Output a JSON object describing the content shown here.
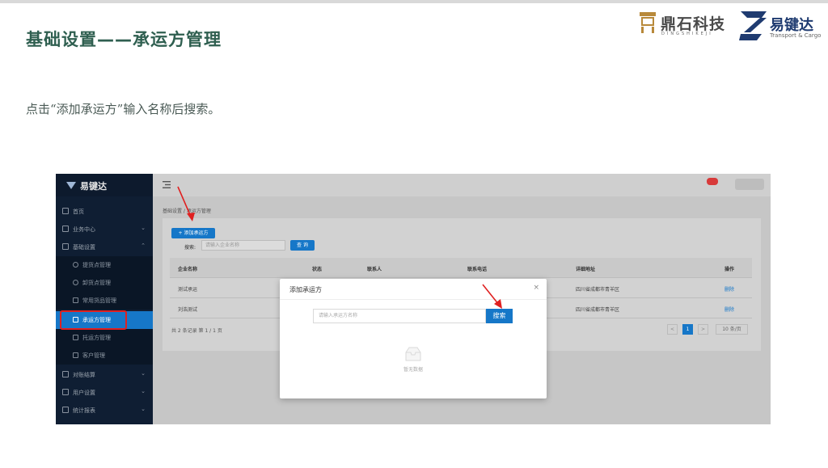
{
  "slide": {
    "title": "基础设置——承运方管理",
    "instruction": "点击“添加承运方”输入名称后搜索。",
    "logo_dingshi": "鼎石科技",
    "logo_dingshi_pinyin": "DINGSHIKEJI",
    "logo_yjd": "易键达",
    "logo_yjd_sub": "Transport & Cargo"
  },
  "sidebar": {
    "brand": "易键达",
    "items": [
      {
        "label": "首页",
        "icon": "home-icon"
      },
      {
        "label": "业务中心",
        "icon": "business-icon",
        "chevron": "⌄"
      },
      {
        "label": "基础设置",
        "icon": "settings-icon",
        "chevron": "⌃"
      },
      {
        "label": "对账结算",
        "icon": "settlement-icon",
        "chevron": "⌄"
      },
      {
        "label": "用户设置",
        "icon": "user-icon",
        "chevron": "⌄"
      },
      {
        "label": "统计报表",
        "icon": "report-icon",
        "chevron": "⌄"
      }
    ],
    "sub_items": [
      {
        "label": "提货点管理"
      },
      {
        "label": "卸货点管理"
      },
      {
        "label": "常用货品管理"
      },
      {
        "label": "承运方管理",
        "active": true
      },
      {
        "label": "托运方管理"
      },
      {
        "label": "客户管理"
      }
    ]
  },
  "main": {
    "breadcrumb": "基础设置 / 承运方管理",
    "add_button": "+ 添加承运方",
    "search_label": "搜索:",
    "search_placeholder": "请输入企业名称",
    "search_button": "查 询",
    "columns": [
      "企业名称",
      "状态",
      "联系人",
      "联系电话",
      "详细地址",
      "操作"
    ],
    "rows": [
      {
        "name": "测试承运",
        "address": "四川省成都市青羊区",
        "action": "删除"
      },
      {
        "name": "刘浩测试",
        "address": "四川省成都市青羊区",
        "action": "删除"
      }
    ],
    "pagination": {
      "total_text": "共 2 条记录 第 1 / 1 页",
      "prev": "<",
      "current": "1",
      "next": ">",
      "page_size": "10 条/页"
    }
  },
  "modal": {
    "title": "添加承运方",
    "close": "×",
    "input_placeholder": "请输入承运方名称",
    "search_button": "搜索",
    "empty_text": "暂无数据"
  },
  "colors": {
    "title_green": "#2f5f50",
    "sidebar_bg": "#0f1e33",
    "primary_blue": "#1677c8",
    "highlight_red": "#e02020"
  }
}
